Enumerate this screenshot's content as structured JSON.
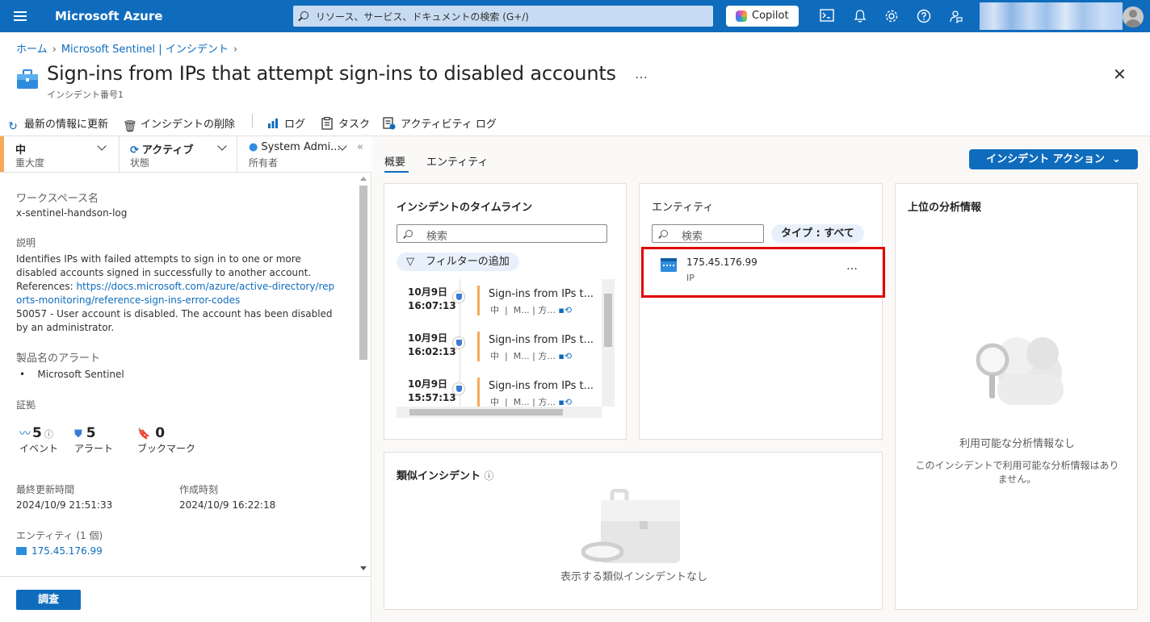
{
  "topbar": {
    "brand": "Microsoft Azure",
    "search_placeholder": "リソース、サービス、ドキュメントの検索 (G+/)",
    "copilot": "Copilot"
  },
  "breadcrumb": {
    "home": "ホーム",
    "sentinel": "Microsoft Sentinel | インシデント"
  },
  "header": {
    "title": "Sign-ins from IPs that attempt sign-ins to disabled accounts",
    "subtitle": "インシデント番号1",
    "more": "…",
    "close": "✕"
  },
  "commands": {
    "refresh": "最新の情報に更新",
    "delete": "インシデントの削除",
    "logs": "ログ",
    "tasks": "タスク",
    "activity": "アクティビティ ログ"
  },
  "fields": {
    "severity": {
      "value": "中",
      "label": "重大度"
    },
    "status": {
      "value": "アクティブ",
      "label": "状態"
    },
    "owner": {
      "value": "System Admi...",
      "label": "所有者"
    }
  },
  "details": {
    "workspace_label": "ワークスペース名",
    "workspace": "x-sentinel-handson-log",
    "description_label": "説明",
    "description_1": "Identifies IPs with failed attempts to sign in to one or more disabled accounts signed in successfully to another account.",
    "references_prefix": "References: ",
    "references_link": "https://docs.microsoft.com/azure/active-directory/reports-monitoring/reference-sign-ins-error-codes",
    "description_2": "50057 - User account is disabled. The account has been disabled by an administrator.",
    "product_label": "製品名のアラート",
    "product": "Microsoft Sentinel",
    "evidence_label": "証拠",
    "events_count": "5",
    "events_label": "イベント",
    "alerts_count": "5",
    "alerts_label": "アラート",
    "bookmarks_count": "0",
    "bookmarks_label": "ブックマーク",
    "updated_label": "最終更新時間",
    "updated": "2024/10/9 21:51:33",
    "created_label": "作成時刻",
    "created": "2024/10/9 16:22:18",
    "entities_label": "エンティティ (1 個)",
    "entity_ip": "175.45.176.99",
    "investigate": "調査"
  },
  "tabs": {
    "overview": "概要",
    "entities": "エンティティ"
  },
  "incident_action": "インシデント アクション",
  "timeline": {
    "title": "インシデントのタイムライン",
    "search": "検索",
    "filter": "フィルターの追加",
    "items": [
      {
        "date": "10月9日",
        "time": "16:07:13",
        "title": "Sign-ins from IPs t...",
        "sev": "中",
        "m2": "M...",
        "m3": "方..."
      },
      {
        "date": "10月9日",
        "time": "16:02:13",
        "title": "Sign-ins from IPs t...",
        "sev": "中",
        "m2": "M...",
        "m3": "方..."
      },
      {
        "date": "10月9日",
        "time": "15:57:13",
        "title": "Sign-ins from IPs t...",
        "sev": "中",
        "m2": "M...",
        "m3": "方..."
      }
    ]
  },
  "entities": {
    "title": "エンティティ",
    "search": "検索",
    "type_filter": "タイプ : すべて",
    "item_ip": "175.45.176.99",
    "item_type": "IP",
    "item_more": "…"
  },
  "insights": {
    "title": "上位の分析情報",
    "empty_title": "利用可能な分析情報なし",
    "empty_desc": "このインシデントで利用可能な分析情報はありません。"
  },
  "similar": {
    "title": "類似インシデント",
    "empty": "表示する類似インシデントなし"
  }
}
